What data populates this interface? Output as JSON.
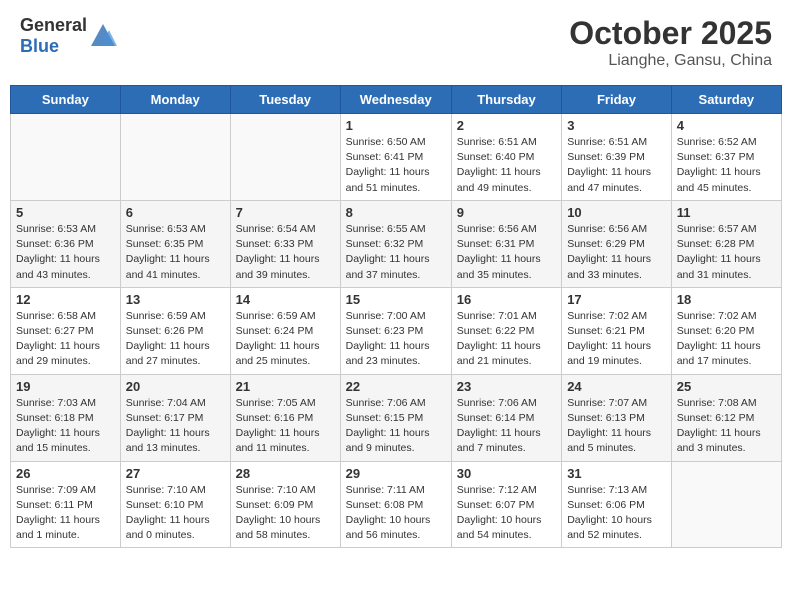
{
  "header": {
    "logo_general": "General",
    "logo_blue": "Blue",
    "month_title": "October 2025",
    "location": "Lianghe, Gansu, China"
  },
  "days_of_week": [
    "Sunday",
    "Monday",
    "Tuesday",
    "Wednesday",
    "Thursday",
    "Friday",
    "Saturday"
  ],
  "weeks": [
    [
      {
        "day": "",
        "info": ""
      },
      {
        "day": "",
        "info": ""
      },
      {
        "day": "",
        "info": ""
      },
      {
        "day": "1",
        "info": "Sunrise: 6:50 AM\nSunset: 6:41 PM\nDaylight: 11 hours\nand 51 minutes."
      },
      {
        "day": "2",
        "info": "Sunrise: 6:51 AM\nSunset: 6:40 PM\nDaylight: 11 hours\nand 49 minutes."
      },
      {
        "day": "3",
        "info": "Sunrise: 6:51 AM\nSunset: 6:39 PM\nDaylight: 11 hours\nand 47 minutes."
      },
      {
        "day": "4",
        "info": "Sunrise: 6:52 AM\nSunset: 6:37 PM\nDaylight: 11 hours\nand 45 minutes."
      }
    ],
    [
      {
        "day": "5",
        "info": "Sunrise: 6:53 AM\nSunset: 6:36 PM\nDaylight: 11 hours\nand 43 minutes."
      },
      {
        "day": "6",
        "info": "Sunrise: 6:53 AM\nSunset: 6:35 PM\nDaylight: 11 hours\nand 41 minutes."
      },
      {
        "day": "7",
        "info": "Sunrise: 6:54 AM\nSunset: 6:33 PM\nDaylight: 11 hours\nand 39 minutes."
      },
      {
        "day": "8",
        "info": "Sunrise: 6:55 AM\nSunset: 6:32 PM\nDaylight: 11 hours\nand 37 minutes."
      },
      {
        "day": "9",
        "info": "Sunrise: 6:56 AM\nSunset: 6:31 PM\nDaylight: 11 hours\nand 35 minutes."
      },
      {
        "day": "10",
        "info": "Sunrise: 6:56 AM\nSunset: 6:29 PM\nDaylight: 11 hours\nand 33 minutes."
      },
      {
        "day": "11",
        "info": "Sunrise: 6:57 AM\nSunset: 6:28 PM\nDaylight: 11 hours\nand 31 minutes."
      }
    ],
    [
      {
        "day": "12",
        "info": "Sunrise: 6:58 AM\nSunset: 6:27 PM\nDaylight: 11 hours\nand 29 minutes."
      },
      {
        "day": "13",
        "info": "Sunrise: 6:59 AM\nSunset: 6:26 PM\nDaylight: 11 hours\nand 27 minutes."
      },
      {
        "day": "14",
        "info": "Sunrise: 6:59 AM\nSunset: 6:24 PM\nDaylight: 11 hours\nand 25 minutes."
      },
      {
        "day": "15",
        "info": "Sunrise: 7:00 AM\nSunset: 6:23 PM\nDaylight: 11 hours\nand 23 minutes."
      },
      {
        "day": "16",
        "info": "Sunrise: 7:01 AM\nSunset: 6:22 PM\nDaylight: 11 hours\nand 21 minutes."
      },
      {
        "day": "17",
        "info": "Sunrise: 7:02 AM\nSunset: 6:21 PM\nDaylight: 11 hours\nand 19 minutes."
      },
      {
        "day": "18",
        "info": "Sunrise: 7:02 AM\nSunset: 6:20 PM\nDaylight: 11 hours\nand 17 minutes."
      }
    ],
    [
      {
        "day": "19",
        "info": "Sunrise: 7:03 AM\nSunset: 6:18 PM\nDaylight: 11 hours\nand 15 minutes."
      },
      {
        "day": "20",
        "info": "Sunrise: 7:04 AM\nSunset: 6:17 PM\nDaylight: 11 hours\nand 13 minutes."
      },
      {
        "day": "21",
        "info": "Sunrise: 7:05 AM\nSunset: 6:16 PM\nDaylight: 11 hours\nand 11 minutes."
      },
      {
        "day": "22",
        "info": "Sunrise: 7:06 AM\nSunset: 6:15 PM\nDaylight: 11 hours\nand 9 minutes."
      },
      {
        "day": "23",
        "info": "Sunrise: 7:06 AM\nSunset: 6:14 PM\nDaylight: 11 hours\nand 7 minutes."
      },
      {
        "day": "24",
        "info": "Sunrise: 7:07 AM\nSunset: 6:13 PM\nDaylight: 11 hours\nand 5 minutes."
      },
      {
        "day": "25",
        "info": "Sunrise: 7:08 AM\nSunset: 6:12 PM\nDaylight: 11 hours\nand 3 minutes."
      }
    ],
    [
      {
        "day": "26",
        "info": "Sunrise: 7:09 AM\nSunset: 6:11 PM\nDaylight: 11 hours\nand 1 minute."
      },
      {
        "day": "27",
        "info": "Sunrise: 7:10 AM\nSunset: 6:10 PM\nDaylight: 11 hours\nand 0 minutes."
      },
      {
        "day": "28",
        "info": "Sunrise: 7:10 AM\nSunset: 6:09 PM\nDaylight: 10 hours\nand 58 minutes."
      },
      {
        "day": "29",
        "info": "Sunrise: 7:11 AM\nSunset: 6:08 PM\nDaylight: 10 hours\nand 56 minutes."
      },
      {
        "day": "30",
        "info": "Sunrise: 7:12 AM\nSunset: 6:07 PM\nDaylight: 10 hours\nand 54 minutes."
      },
      {
        "day": "31",
        "info": "Sunrise: 7:13 AM\nSunset: 6:06 PM\nDaylight: 10 hours\nand 52 minutes."
      },
      {
        "day": "",
        "info": ""
      }
    ]
  ]
}
